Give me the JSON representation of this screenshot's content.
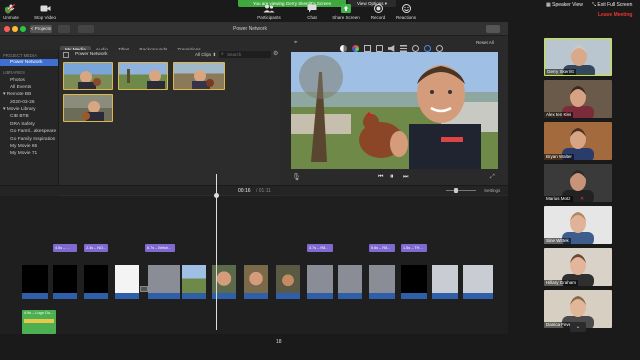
{
  "zoom": {
    "share_banner": "You are viewing Gerry Skerritt's Screen",
    "view_options": "View Options ▾",
    "speaker_view": "Speaker View",
    "exit_full_screen": "Exit Full Screen",
    "participant_count": "18",
    "toolbar": {
      "unmute": "Unmute",
      "stop_video": "Stop Video",
      "participants": "Participants",
      "chat": "Chat",
      "share_screen": "Share Screen",
      "record": "Record",
      "reactions": "Reactions",
      "leave": "Leave Meeting"
    },
    "participants": [
      {
        "name": "Gerry Skerritt",
        "bg": "#b9c6cf",
        "shirt": "#34475c",
        "skin": "#d9a98b",
        "hair": "#c9c9c9"
      },
      {
        "name": "Alex ten Klei",
        "bg": "#6a5a4a",
        "shirt": "#7b2b3a",
        "skin": "#d6a184",
        "hair": "#3a2a1e"
      },
      {
        "name": "Bryan Walter",
        "bg": "#a36a3e",
        "shirt": "#2a3d6a",
        "skin": "#d8a584",
        "hair": "#4a3020"
      },
      {
        "name": "Marius Motz",
        "bg": "#3a3a3a",
        "shirt": "#222",
        "skin": "#c89478",
        "hair": "#2a2a2a"
      },
      {
        "name": "Sine Wittek",
        "bg": "#e6e6e6",
        "shirt": "#3d5d8d",
        "skin": "#e0b398",
        "hair": "#b08a5a"
      },
      {
        "name": "Hillary Graham",
        "bg": "#d8d2c8",
        "shirt": "#2f2f2f",
        "skin": "#e3b59a",
        "hair": "#6a4a2e"
      },
      {
        "name": "Danica Feve",
        "bg": "#d6cfc2",
        "shirt": "#4a4a4a",
        "skin": "#e2b699",
        "hair": "#8a6a44"
      }
    ]
  },
  "imovie": {
    "projects_btn": "< Projects",
    "window_title": "Power Network",
    "tabs": [
      "My Media",
      "Audio",
      "Titles",
      "Backgrounds",
      "Transitions"
    ],
    "sidebar": {
      "project_media_header": "PROJECT MEDIA",
      "project": "Power Network",
      "libraries_header": "LIBRARIES",
      "items": [
        {
          "label": "Photos",
          "level": "l2"
        },
        {
          "label": "All Events",
          "level": "l2"
        },
        {
          "label": "▾ Remote BB",
          "level": "l1"
        },
        {
          "label": "2020-03-26",
          "level": "l2"
        },
        {
          "label": "▾ Movie Library",
          "level": "l1"
        },
        {
          "label": "CIB BTB",
          "level": "l2"
        },
        {
          "label": "DRA Safety",
          "level": "l2"
        },
        {
          "label": "Go FamIl...akespeare",
          "level": "l2"
        },
        {
          "label": "Go Family Inspiration",
          "level": "l2"
        },
        {
          "label": "My Movie 65",
          "level": "l2"
        },
        {
          "label": "My Movie 71",
          "level": "l2"
        }
      ]
    },
    "browser": {
      "label": "Power Network",
      "all_clips": "All Clips ⬍",
      "search_placeholder": "Search"
    },
    "viewer": {
      "reset_all": "Reset All"
    },
    "timeline": {
      "timecode": "00:16",
      "total": "/ 01:11",
      "settings": "Settings",
      "title_clips": [
        "4.5s – ...",
        "2.3s – NO...",
        "6.7s – Britsh...",
        "3.7s – R8...",
        "5.6s – R8...",
        "1.5s – TH..."
      ],
      "audio_clip": "4.9s – Logo Ou..."
    }
  }
}
